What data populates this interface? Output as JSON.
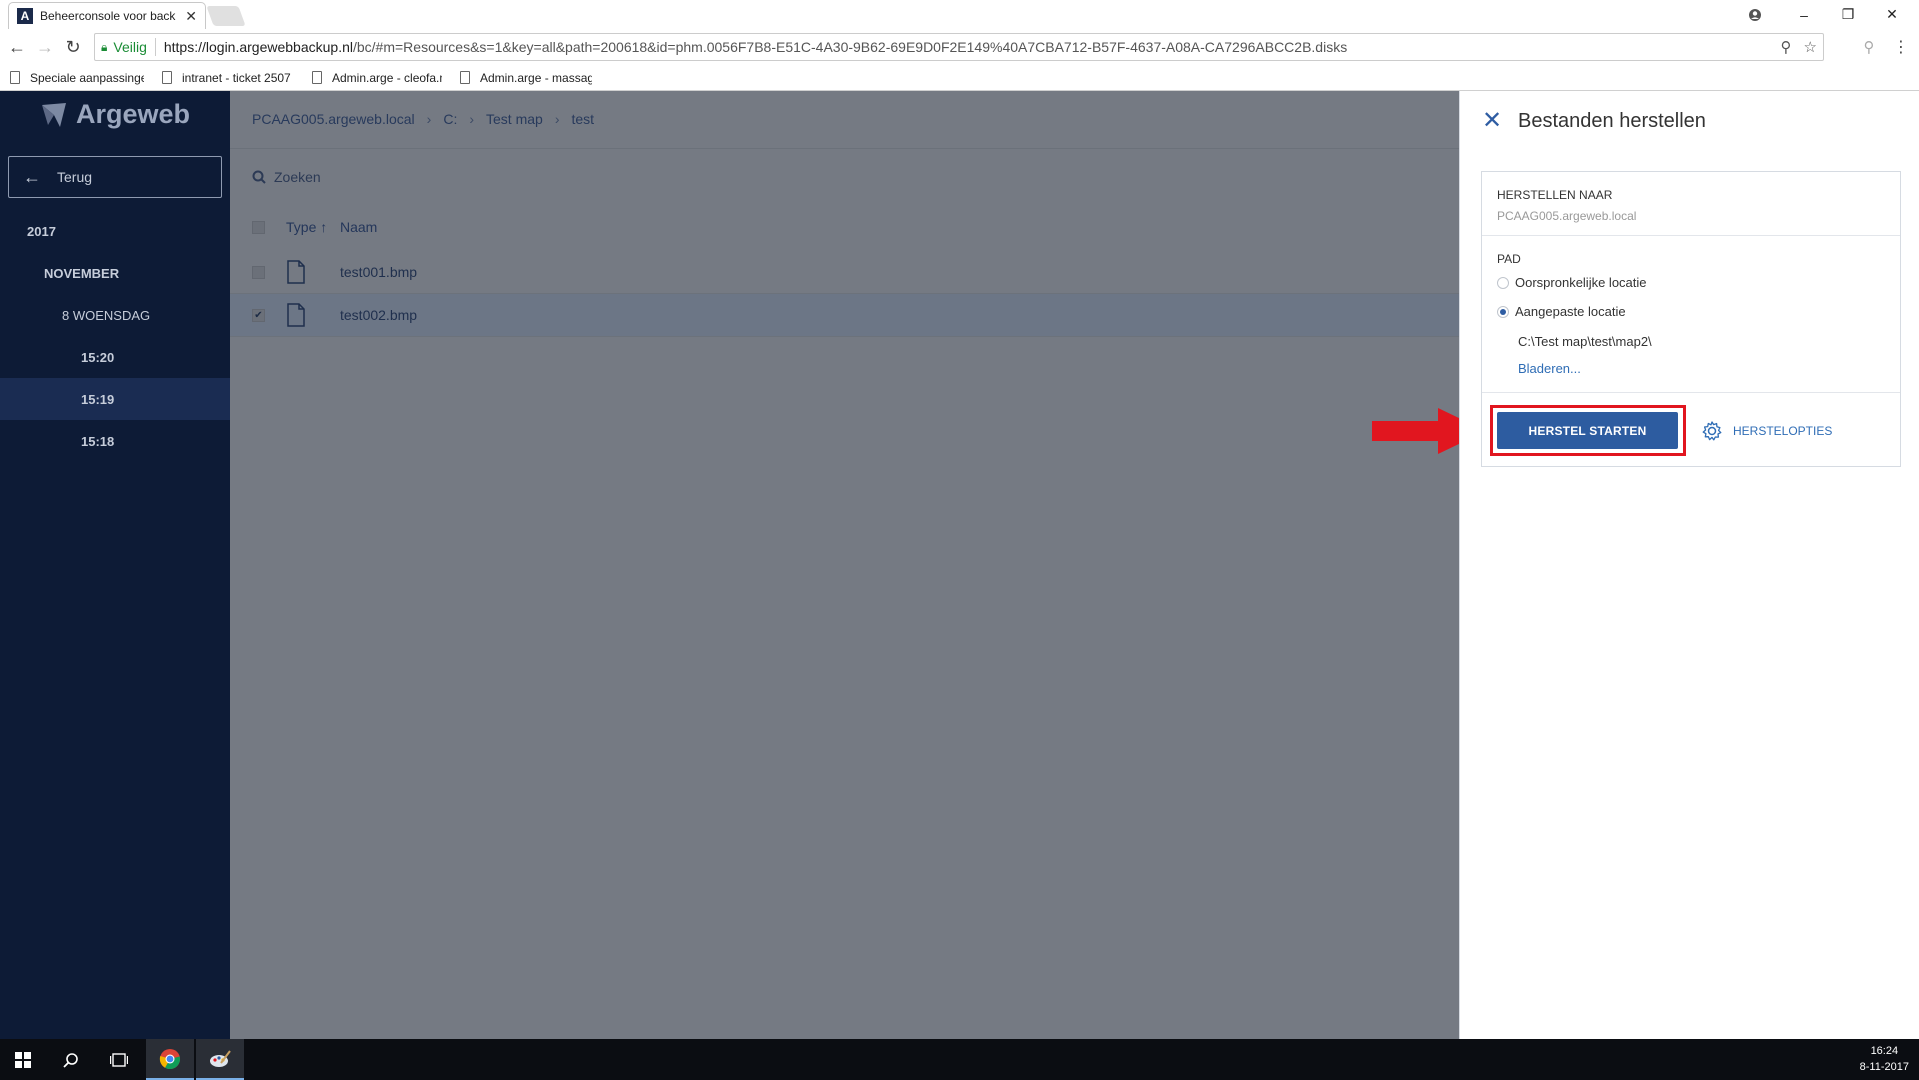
{
  "browser": {
    "tab_title": "Beheerconsole voor back",
    "favicon_letter": "A",
    "secure_label": "Veilig",
    "url_origin": "https://login.argewebbackup.nl",
    "url_path": "/bc/#m=Resources&s=1&key=all&path=200618&id=phm.0056F7B8-E51C-4A30-9B62-69E9D0F2E149%40A7CBA712-B57F-4637-A08A-CA7296ABCC2B.disks",
    "bookmarks": [
      "Speciale aanpassinge",
      "intranet - ticket 2507",
      "Admin.arge - cleofa.n",
      "Admin.arge - massag"
    ]
  },
  "sidebar": {
    "logo": "Argeweb",
    "back_label": "Terug",
    "items": [
      {
        "label": "2017"
      },
      {
        "label": "NOVEMBER"
      },
      {
        "label": "8 WOENSDAG"
      },
      {
        "label": "15:20"
      },
      {
        "label": "15:19",
        "active": true
      },
      {
        "label": "15:18"
      }
    ]
  },
  "main": {
    "breadcrumb": [
      "PCAAG005.argeweb.local",
      "C:",
      "Test map",
      "test"
    ],
    "search_placeholder": "Zoeken",
    "columns": {
      "type": "Type",
      "name": "Naam"
    },
    "rows": [
      {
        "name": "test001.bmp",
        "checked": false
      },
      {
        "name": "test002.bmp",
        "checked": true
      }
    ]
  },
  "panel": {
    "title": "Bestanden herstellen",
    "restore_to_label": "HERSTELLEN NAAR",
    "restore_to_value": "PCAAG005.argeweb.local",
    "path_label": "PAD",
    "option_original": "Oorspronkelijke locatie",
    "option_custom": "Aangepaste locatie",
    "custom_path": "C:\\Test map\\test\\map2\\",
    "browse_label": "Bladeren...",
    "start_button": "HERSTEL STARTEN",
    "options_link": "HERSTELOPTIES"
  },
  "taskbar": {
    "time": "16:24",
    "date": "8-11-2017"
  },
  "colors": {
    "sidebar_bg": "#0d1b36",
    "overlay_bg": "#757a83",
    "accent": "#2d5ca0",
    "highlight": "#e1161f"
  }
}
